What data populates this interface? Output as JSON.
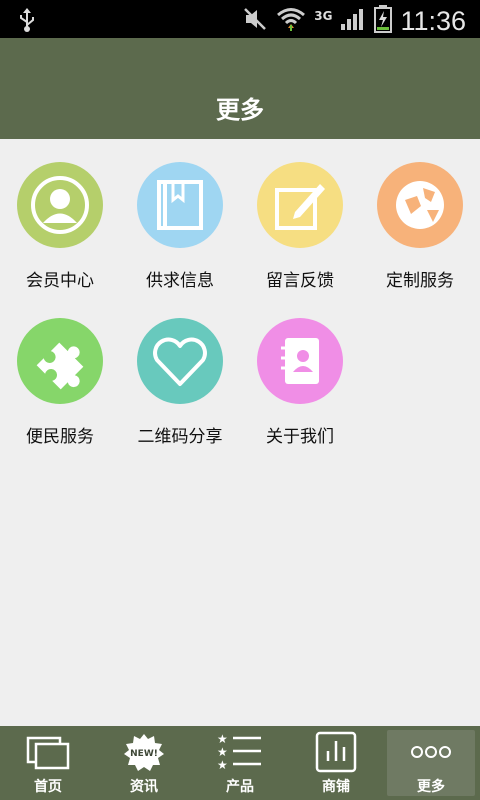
{
  "status_bar": {
    "network_type": "3G",
    "time": "11:36",
    "icons": [
      "usb-icon",
      "mute-icon",
      "wifi-icon",
      "signal-icon",
      "battery-charging-icon"
    ]
  },
  "header": {
    "title": "更多"
  },
  "tiles": [
    {
      "label": "会员中心",
      "icon": "member-icon",
      "color": "#b5cf6b"
    },
    {
      "label": "供求信息",
      "icon": "book-icon",
      "color": "#9fd6f2"
    },
    {
      "label": "留言反馈",
      "icon": "edit-note-icon",
      "color": "#f6de82"
    },
    {
      "label": "定制服务",
      "icon": "globe-icon",
      "color": "#f7b27a"
    },
    {
      "label": "便民服务",
      "icon": "puzzle-icon",
      "color": "#86d66a"
    },
    {
      "label": "二维码分享",
      "icon": "heart-icon",
      "color": "#68c9bd"
    },
    {
      "label": "关于我们",
      "icon": "contact-book-icon",
      "color": "#f08ee6"
    }
  ],
  "tabbar": {
    "items": [
      {
        "label": "首页",
        "icon": "windows-icon",
        "active": false
      },
      {
        "label": "资讯",
        "icon": "new-badge-icon",
        "badge_text": "NEW!",
        "active": false
      },
      {
        "label": "产品",
        "icon": "list-stars-icon",
        "active": false
      },
      {
        "label": "商铺",
        "icon": "bar-chart-icon",
        "active": false
      },
      {
        "label": "更多",
        "icon": "more-icon",
        "active": true
      }
    ]
  }
}
